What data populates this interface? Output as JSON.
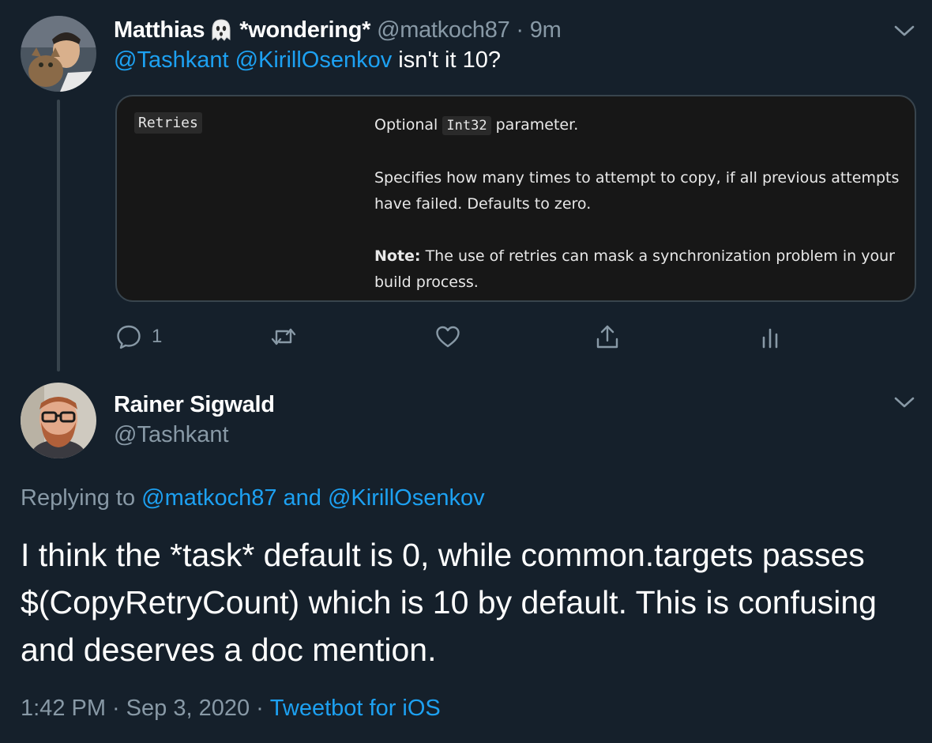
{
  "tweet1": {
    "author_name": "Matthias",
    "author_emoji": "ghost-icon",
    "author_status": "*wondering*",
    "handle": "@matkoch87",
    "separator": "·",
    "time": "9m",
    "text": {
      "mention1": "@Tashkant",
      "mention2": "@KirillOsenkov",
      "rest": "isn't it 10?"
    },
    "card": {
      "param_name": "Retries",
      "line1_prefix": "Optional",
      "line1_code": "Int32",
      "line1_suffix": "parameter.",
      "paragraph2": "Specifies how many times to attempt to copy, if all previous attempts have failed. Defaults to zero.",
      "note_label": "Note:",
      "note_text": "The use of retries can mask a synchronization problem in your build process."
    },
    "actions": {
      "reply_count": "1"
    }
  },
  "tweet2": {
    "author_name": "Rainer Sigwald",
    "handle": "@Tashkant",
    "replying_prefix": "Replying to",
    "replying_mention1": "@matkoch87",
    "replying_and": "and",
    "replying_mention2": "@KirillOsenkov",
    "body": "I think the *task* default is 0, while common.targets passes $(CopyRetryCount) which is 10 by default. This is confusing and deserves a doc mention.",
    "timestamp": "1:42 PM",
    "separator": "·",
    "date": "Sep 3, 2020",
    "source": "Tweetbot for iOS"
  },
  "colors": {
    "background": "#15202b",
    "link": "#1da1f2",
    "muted": "#8899a6",
    "border": "#38444d"
  }
}
